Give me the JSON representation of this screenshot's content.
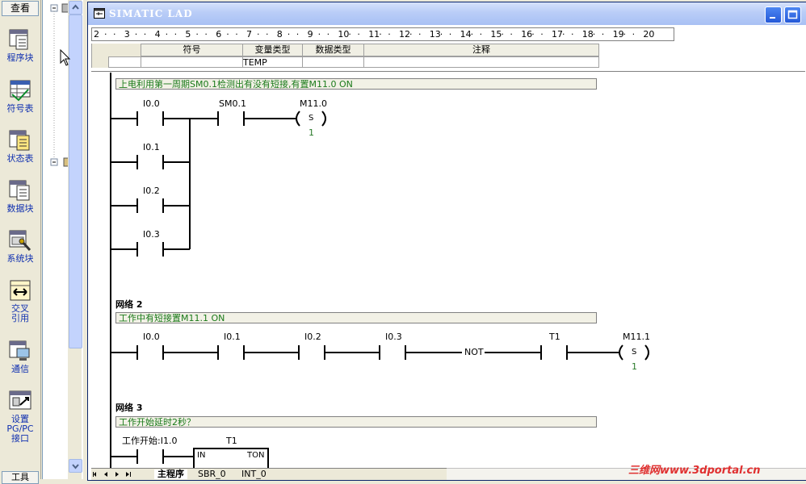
{
  "nav": {
    "header": "查看",
    "items": [
      {
        "label": "程序块"
      },
      {
        "label": "符号表"
      },
      {
        "label": "状态表"
      },
      {
        "label": "数据块"
      },
      {
        "label": "系统块"
      },
      {
        "label": "交叉引用"
      },
      {
        "label": "通信"
      },
      {
        "label": "设置PG/PC接口"
      }
    ],
    "footer": "工具"
  },
  "window": {
    "title": "SIMATIC LAD"
  },
  "ruler": {
    "numbers": [
      "2",
      "3",
      "4",
      "5",
      "6",
      "7",
      "8",
      "9",
      "10",
      "11",
      "12",
      "13",
      "14",
      "15",
      "16",
      "17",
      "18",
      "19",
      "20"
    ]
  },
  "var_table": {
    "headers": [
      "符号",
      "变量类型",
      "数据类型",
      "注释"
    ],
    "row1": {
      "var_type": "TEMP"
    }
  },
  "networks": [
    {
      "title": "",
      "comment": "上电利用第一周期SM0.1检测出有没有短接,有置M11.0 ON",
      "contacts": [
        "I0.0",
        "SM0.1",
        "I0.1",
        "I0.2",
        "I0.3"
      ],
      "coil": {
        "address": "M11.0",
        "type": "S",
        "value": "1"
      }
    },
    {
      "title": "网络 2",
      "comment": "工作中有短接置M11.1 ON",
      "contacts": [
        "I0.0",
        "I0.1",
        "I0.2",
        "I0.3",
        "T1"
      ],
      "not_label": "NOT",
      "coil": {
        "address": "M11.1",
        "type": "S",
        "value": "1"
      }
    },
    {
      "title": "网络 3",
      "comment": "工作开始延时2秒？",
      "contacts": [
        "工作开始:I1.0"
      ],
      "timer": {
        "name": "T1",
        "in": "IN",
        "type": "TON"
      }
    }
  ],
  "tabs": [
    "主程序",
    "SBR_0",
    "INT_0"
  ],
  "watermark": "三维网www.3dportal.cn"
}
